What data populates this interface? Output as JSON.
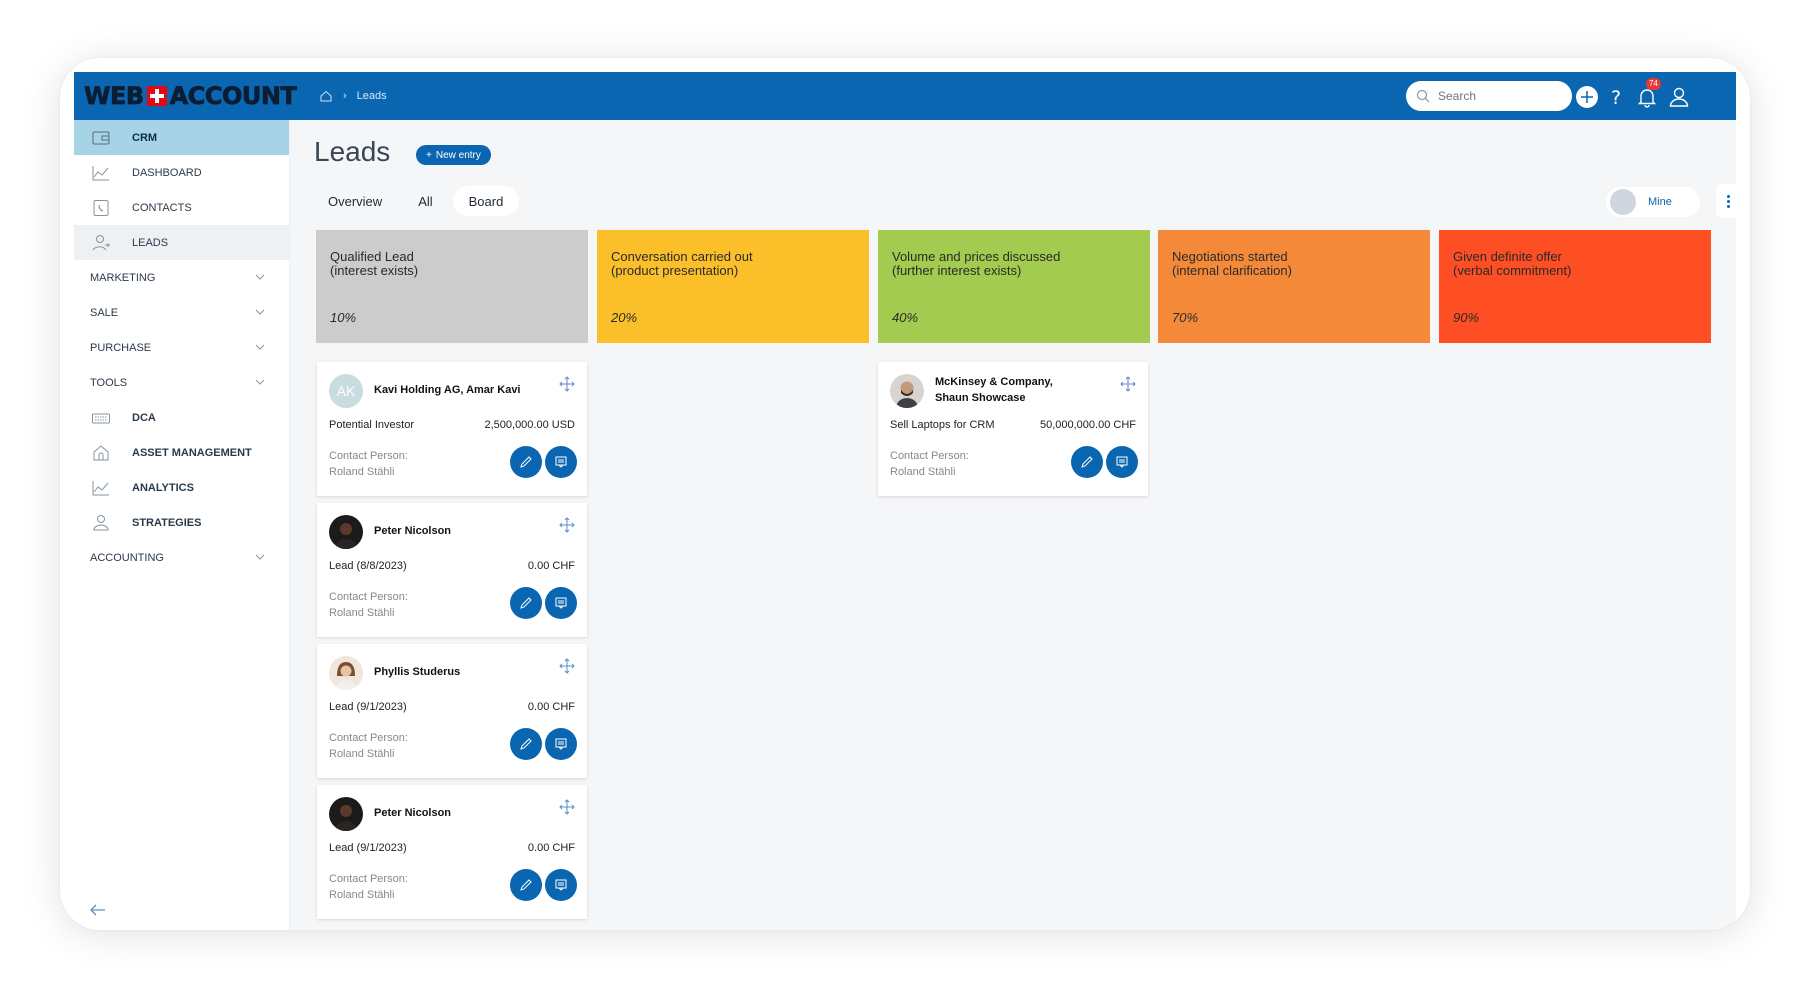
{
  "brand": {
    "logo_left": "WEB",
    "logo_right": "ACCOUNT"
  },
  "breadcrumb": {
    "current": "Leads"
  },
  "search": {
    "placeholder": "Search"
  },
  "notifications": {
    "count": "74"
  },
  "sidebar": {
    "items": [
      {
        "label": "CRM",
        "icon": "wallet-icon"
      },
      {
        "label": "DASHBOARD",
        "icon": "chart-line-icon"
      },
      {
        "label": "CONTACTS",
        "icon": "phone-book-icon"
      },
      {
        "label": "LEADS",
        "icon": "user-lead-icon"
      },
      {
        "label": "MARKETING"
      },
      {
        "label": "SALE"
      },
      {
        "label": "PURCHASE"
      },
      {
        "label": "TOOLS"
      },
      {
        "label": "DCA",
        "icon": "keyboard-icon"
      },
      {
        "label": "ASSET MANAGEMENT",
        "icon": "house-icon"
      },
      {
        "label": "ANALYTICS",
        "icon": "chart-line-icon"
      },
      {
        "label": "STRATEGIES",
        "icon": "user-icon"
      },
      {
        "label": "ACCOUNTING"
      }
    ]
  },
  "page": {
    "title": "Leads",
    "new_entry": "New entry"
  },
  "tabs": [
    {
      "label": "Overview"
    },
    {
      "label": "All"
    },
    {
      "label": "Board"
    }
  ],
  "filter": {
    "mine": "Mine"
  },
  "stages": [
    {
      "name": "Qualified Lead\n(interest exists)",
      "pct": "10%",
      "color": "#cccccc"
    },
    {
      "name": "Conversation carried out\n(product presentation)",
      "pct": "20%",
      "color": "#fbbf2a"
    },
    {
      "name": "Volume and prices discussed\n(further interest exists)",
      "pct": "40%",
      "color": "#a2cb4f"
    },
    {
      "name": "Negotiations started\n(internal clarification)",
      "pct": "70%",
      "color": "#f5893a"
    },
    {
      "name": "Given definite offer\n(verbal commitment)",
      "pct": "90%",
      "color": "#fd4f23"
    }
  ],
  "cards": [
    {
      "name": "Kavi Holding AG, Amar Kavi",
      "initials": "AK",
      "desc": "Potential Investor",
      "amount": "2,500,000.00 USD",
      "cp_label": "Contact Person:",
      "cp_name": "Roland Stähli"
    },
    {
      "name": "Peter Nicolson",
      "desc": "Lead (8/8/2023)",
      "amount": "0.00 CHF",
      "cp_label": "Contact Person:",
      "cp_name": "Roland Stähli"
    },
    {
      "name": "Phyllis Studerus",
      "desc": "Lead (9/1/2023)",
      "amount": "0.00 CHF",
      "cp_label": "Contact Person:",
      "cp_name": "Roland Stähli"
    },
    {
      "name": "Peter Nicolson",
      "desc": "Lead (9/1/2023)",
      "amount": "0.00 CHF",
      "cp_label": "Contact Person:",
      "cp_name": "Roland Stähli"
    },
    {
      "name": "McKinsey & Company, Shaun Showcase",
      "desc": "Sell Laptops for CRM",
      "amount": "50,000,000.00 CHF",
      "cp_label": "Contact Person:",
      "cp_name": "Roland Stähli"
    }
  ]
}
